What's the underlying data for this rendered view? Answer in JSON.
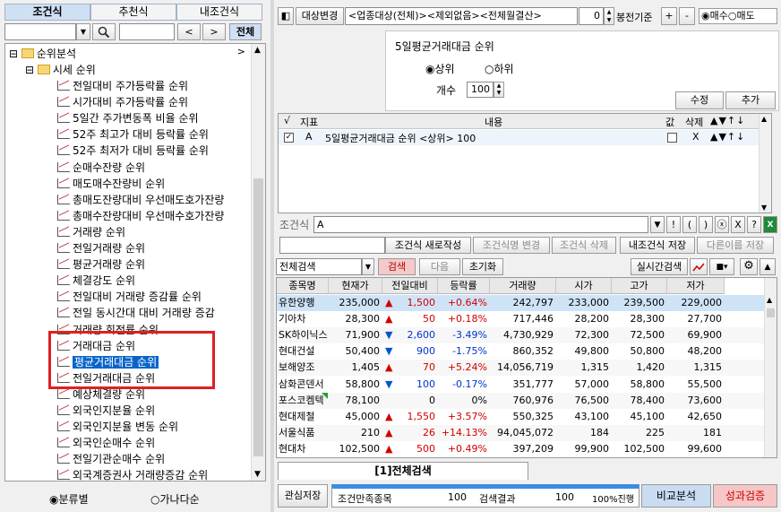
{
  "left_tabs": [
    "조건식",
    "추천식",
    "내조건식"
  ],
  "search": {
    "buttons": [
      "<",
      ">",
      "전체"
    ]
  },
  "tree": {
    "root": "순위분석",
    "folder": "시세 순위",
    "items": [
      "전일대비 주가등락률 순위",
      "시가대비 주가등락률  순위",
      "5일간 주가변동폭 비율 순위",
      "52주 최고가 대비 등락률 순위",
      "52주 최저가 대비 등락률 순위",
      "순매수잔량 순위",
      "매도매수잔량비 순위",
      "총매도잔량대비 우선매도호가잔량",
      "총매수잔량대비 우선매수호가잔량",
      "거래량 순위",
      "전일거래량 순위",
      "평균거래량 순위",
      "체결강도 순위",
      "전일대비 거래량 증감률 순위",
      "전일 동시간대 대비 거래량 증감",
      "거래량 회전률 순위",
      "거래대금 순위",
      "평균거래대금 순위",
      "전일거래대금 순위",
      "예상체결량 순위",
      "외국인지분율 순위",
      "외국인지분율 변동 순위",
      "외국인순매수 순위",
      "전일기관순매수 순위",
      "외국계증권사 거래량증감 순위"
    ]
  },
  "sort_radio": [
    "분류별",
    "가나다순"
  ],
  "top_bar": {
    "target_button": "대상변경",
    "target_text": "<업종대상(전체)><제외없음><전체월결산>",
    "spin_value": "0",
    "candle_label": "봉전기준",
    "plus": "+",
    "minus": "-",
    "buy_label": "매수",
    "sell_label": "매도"
  },
  "condition_editor": {
    "title": "5일평균거래대금 순위",
    "radio_top": "상위",
    "radio_bottom": "하위",
    "count_label": "개수",
    "count_value": "100",
    "edit_button": "수정",
    "add_button": "추가"
  },
  "cond_list": {
    "headers": [
      "√",
      "지표",
      "내용",
      "값",
      "삭제",
      "▲▼↑↓"
    ],
    "rows": [
      {
        "indicator": "A",
        "content": "5일평균거래대금 순위 <상위> 100",
        "delete": "X",
        "arrows": "▲▼↑↓"
      }
    ]
  },
  "formula": {
    "label": "조건식",
    "value": "A",
    "ops": [
      "▼",
      "!",
      "(",
      ")",
      "ⓧ",
      "X",
      "?"
    ]
  },
  "cond_actions": [
    "조건식 새로작성",
    "조건식명 변경",
    "조건식 삭제",
    "내조건식 저장",
    "다른이름 저장"
  ],
  "search_bar": {
    "mode": "전체검색",
    "search_button": "검색",
    "next_button": "다음",
    "reset_button": "초기화",
    "realtime_button": "실시간검색"
  },
  "result_table": {
    "headers": [
      "종목명",
      "현재가",
      "전일대비",
      "등락률",
      "거래량",
      "시가",
      "고가",
      "저가"
    ],
    "rows": [
      {
        "name": "유한양행",
        "price": "235,000",
        "dir": "up",
        "change": "1,500",
        "rate": "+0.64%",
        "volume": "242,797",
        "open": "233,000",
        "high": "239,500",
        "low": "229,000"
      },
      {
        "name": "기아차",
        "price": "28,300",
        "dir": "up",
        "change": "50",
        "rate": "+0.18%",
        "volume": "717,446",
        "open": "28,200",
        "high": "28,300",
        "low": "27,700"
      },
      {
        "name": "SK하이닉스",
        "price": "71,900",
        "dir": "down",
        "change": "2,600",
        "rate": "-3.49%",
        "volume": "4,730,929",
        "open": "72,300",
        "high": "72,500",
        "low": "69,900"
      },
      {
        "name": "현대건설",
        "price": "50,400",
        "dir": "down",
        "change": "900",
        "rate": "-1.75%",
        "volume": "860,352",
        "open": "49,800",
        "high": "50,800",
        "low": "48,200"
      },
      {
        "name": "보해양조",
        "price": "1,405",
        "dir": "up",
        "change": "70",
        "rate": "+5.24%",
        "volume": "14,056,719",
        "open": "1,315",
        "high": "1,420",
        "low": "1,315"
      },
      {
        "name": "삼화콘덴서",
        "price": "58,800",
        "dir": "down",
        "change": "100",
        "rate": "-0.17%",
        "volume": "351,777",
        "open": "57,000",
        "high": "58,800",
        "low": "55,500"
      },
      {
        "name": "포스코켐텍",
        "price": "78,100",
        "dir": "none",
        "change": "0",
        "rate": "0%",
        "volume": "760,976",
        "open": "76,500",
        "high": "78,400",
        "low": "73,600"
      },
      {
        "name": "현대제철",
        "price": "45,000",
        "dir": "up",
        "change": "1,550",
        "rate": "+3.57%",
        "volume": "550,325",
        "open": "43,100",
        "high": "45,100",
        "low": "42,650"
      },
      {
        "name": "서울식품",
        "price": "210",
        "dir": "up",
        "change": "26",
        "rate": "+14.13%",
        "volume": "94,045,072",
        "open": "184",
        "high": "225",
        "low": "181"
      },
      {
        "name": "현대차",
        "price": "102,500",
        "dir": "up",
        "change": "500",
        "rate": "+0.49%",
        "volume": "397,209",
        "open": "99,900",
        "high": "102,500",
        "low": "99,600"
      }
    ]
  },
  "result_tab": "[1]전체검색",
  "footer": {
    "save_button": "관심저장",
    "match_label": "조건만족종목",
    "match_value": "100",
    "result_label": "검색결과",
    "result_value": "100",
    "progress_text": "100%진행",
    "progress": 1.0,
    "compare_button": "비교분석",
    "verify_button": "성과검증"
  },
  "colors": {
    "selection": "#0a64c8",
    "highlight_box": "#e0201f",
    "up": "#d10000",
    "down": "#0033cc",
    "verify_bg": "#f7c6c6",
    "compare_bg": "#c9dcf2"
  }
}
